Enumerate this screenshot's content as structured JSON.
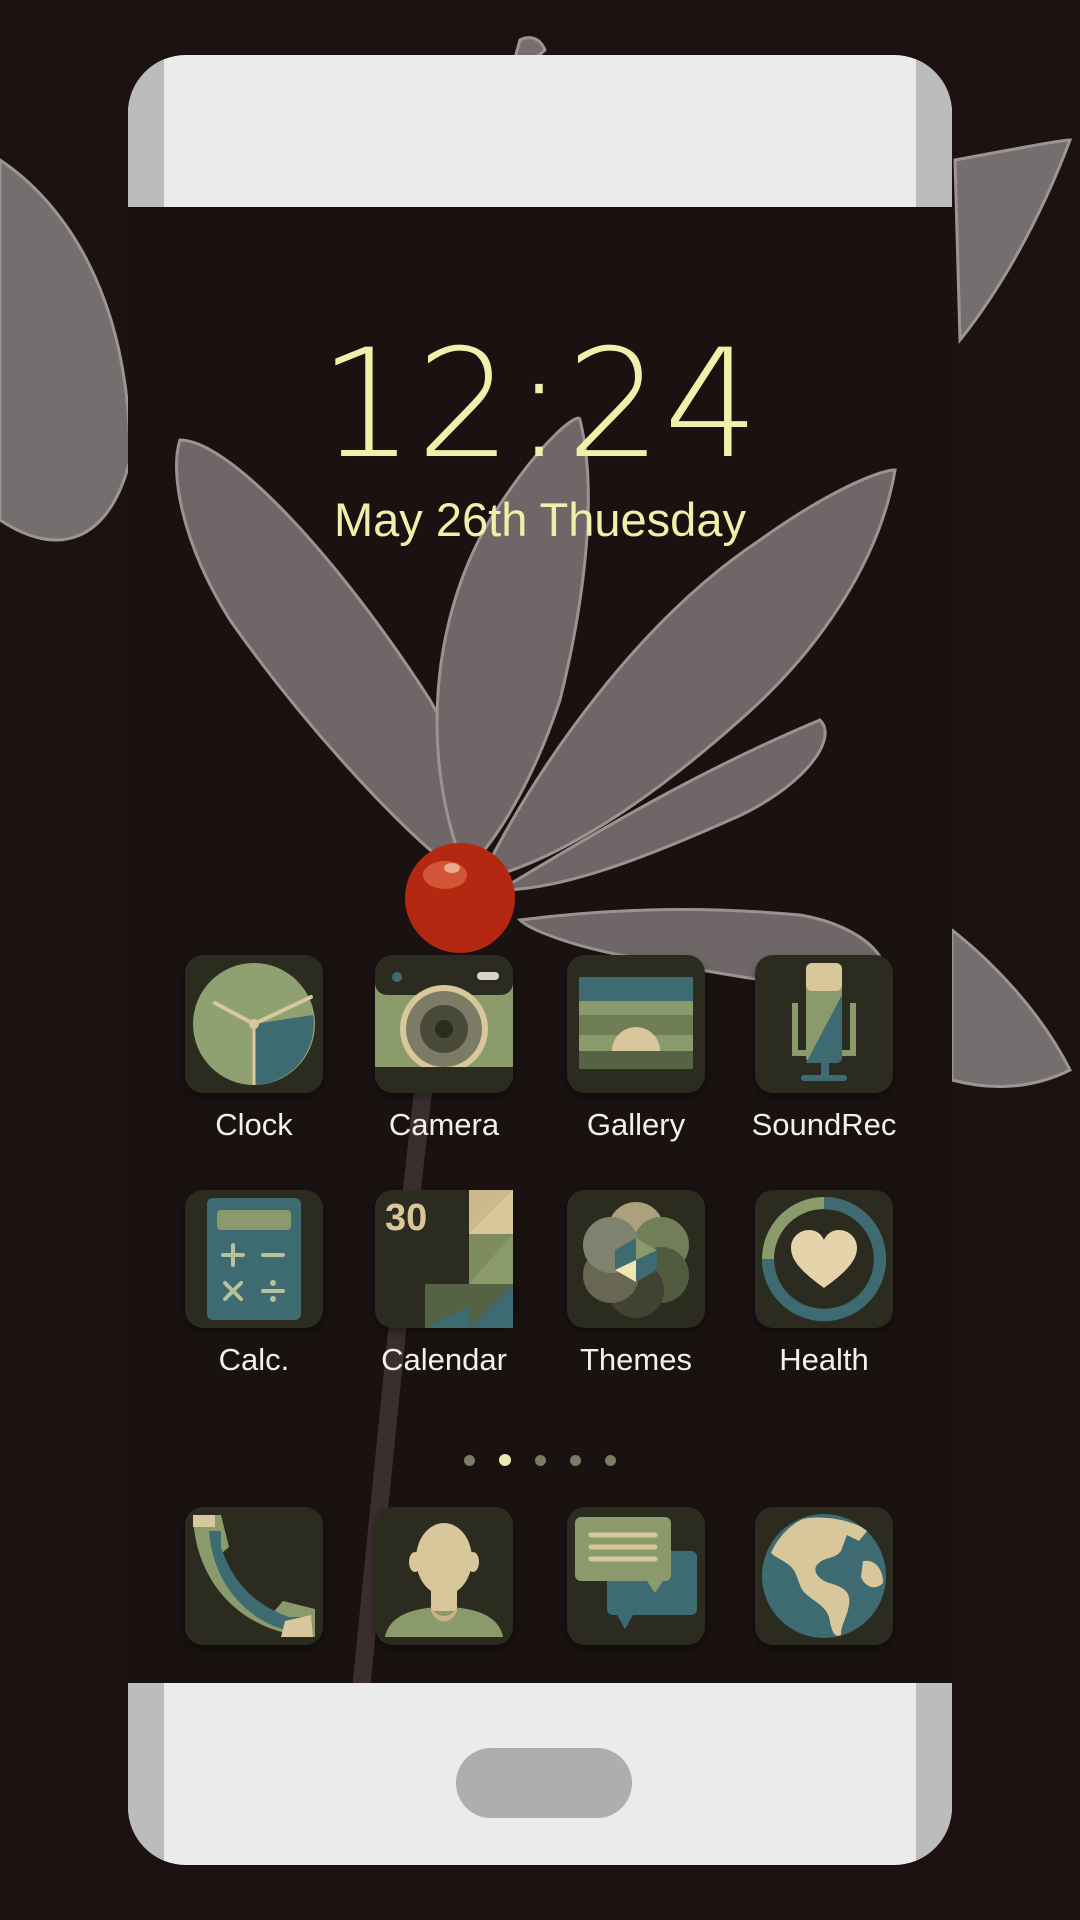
{
  "lockscreen": {
    "time": "12:24",
    "date": "May 26th Thuesday"
  },
  "apps": [
    {
      "label": "Clock",
      "icon": "clock-icon"
    },
    {
      "label": "Camera",
      "icon": "camera-icon"
    },
    {
      "label": "Gallery",
      "icon": "gallery-icon"
    },
    {
      "label": "SoundRec",
      "icon": "microphone-icon"
    },
    {
      "label": "Calc.",
      "icon": "calculator-icon"
    },
    {
      "label": "Calendar",
      "icon": "calendar-icon",
      "day": "30"
    },
    {
      "label": "Themes",
      "icon": "themes-icon"
    },
    {
      "label": "Health",
      "icon": "heart-icon"
    }
  ],
  "dock": [
    {
      "icon": "phone-icon"
    },
    {
      "icon": "contacts-icon"
    },
    {
      "icon": "messages-icon"
    },
    {
      "icon": "browser-globe-icon"
    }
  ],
  "pager": {
    "pages": 5,
    "active": 2
  },
  "colors": {
    "text_accent": "#f1efa9",
    "icon_bg": "#2c2b20",
    "green": "#8a9a6a",
    "teal": "#3e6a72",
    "beige": "#d7c39a"
  }
}
